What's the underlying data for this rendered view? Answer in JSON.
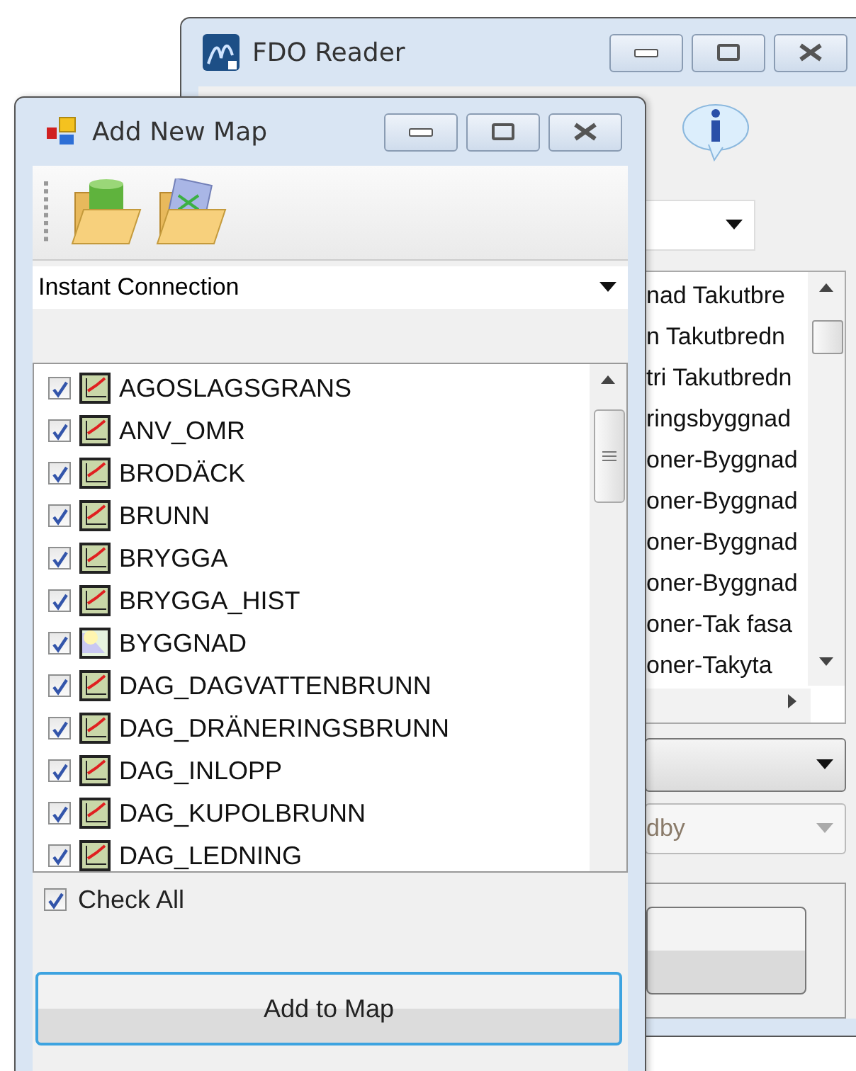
{
  "back_window": {
    "title": "FDO Reader",
    "list_items": [
      "nad Takutbre",
      "n Takutbredn",
      "tri Takutbredn",
      "ringsbyggnad",
      "oner-Byggnad",
      "oner-Byggnad",
      "oner-Byggnad",
      "oner-Byggnad",
      "oner-Tak fasa",
      "oner-Takyta"
    ],
    "disabled_dropdown": {
      "value": "dby",
      "disabled": true
    }
  },
  "front_window": {
    "title": "Add New Map",
    "connection_dropdown": {
      "value": "Instant Connection"
    },
    "layers": [
      {
        "name": "AGOSLAGSGRANS",
        "checked": true,
        "kind": "line"
      },
      {
        "name": "ANV_OMR",
        "checked": true,
        "kind": "line"
      },
      {
        "name": "BRODÄCK",
        "checked": true,
        "kind": "line"
      },
      {
        "name": "BRUNN",
        "checked": true,
        "kind": "line"
      },
      {
        "name": "BRYGGA",
        "checked": true,
        "kind": "line"
      },
      {
        "name": "BRYGGA_HIST",
        "checked": true,
        "kind": "line"
      },
      {
        "name": "BYGGNAD",
        "checked": true,
        "kind": "polygon"
      },
      {
        "name": "DAG_DAGVATTENBRUNN",
        "checked": true,
        "kind": "line"
      },
      {
        "name": "DAG_DRÄNERINGSBRUNN",
        "checked": true,
        "kind": "line"
      },
      {
        "name": "DAG_INLOPP",
        "checked": true,
        "kind": "line"
      },
      {
        "name": "DAG_KUPOLBRUNN",
        "checked": true,
        "kind": "line"
      },
      {
        "name": "DAG_LEDNING",
        "checked": true,
        "kind": "line"
      }
    ],
    "check_all": {
      "label": "Check All",
      "checked": true
    },
    "button": "Add to Map"
  }
}
